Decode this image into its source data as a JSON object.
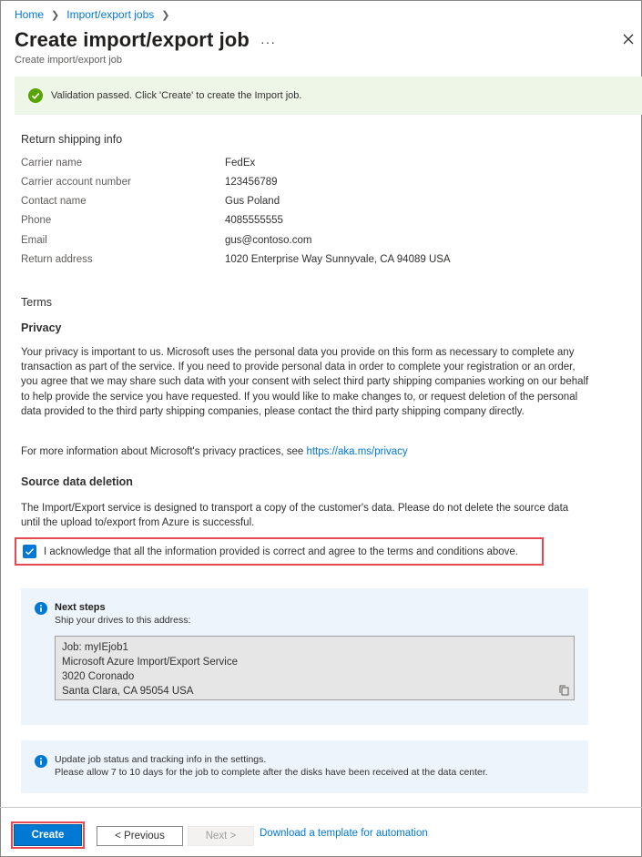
{
  "breadcrumb": [
    "Home",
    "Import/export jobs"
  ],
  "header": {
    "title": "Create import/export job",
    "subtitle": "Create import/export job",
    "more": "···"
  },
  "validation": {
    "message": "Validation passed. Click 'Create' to create the Import job."
  },
  "shipping": {
    "heading": "Return shipping info",
    "rows": [
      {
        "label": "Carrier name",
        "value": "FedEx"
      },
      {
        "label": "Carrier account number",
        "value": "123456789"
      },
      {
        "label": "Contact name",
        "value": "Gus Poland"
      },
      {
        "label": "Phone",
        "value": "4085555555"
      },
      {
        "label": "Email",
        "value": "gus@contoso.com"
      },
      {
        "label": "Return address",
        "value": "1020 Enterprise Way Sunnyvale, CA 94089 USA"
      }
    ]
  },
  "terms": {
    "heading": "Terms",
    "privacy_heading": "Privacy",
    "privacy_text": "Your privacy is important to us. Microsoft uses the personal data you provide on this form as necessary to complete any transaction as part of the service. If you need to provide personal data in order to complete your registration or an order, you agree that we may share such data with your consent with select third party shipping companies working on our behalf to help provide the service you have requested. If you would like to make changes to, or request deletion of the personal data provided to the third party shipping companies, please contact the third party shipping company directly.",
    "more_info_prefix": "For more information about Microsoft's privacy practices, see ",
    "more_info_link": "https://aka.ms/privacy",
    "deletion_heading": "Source data deletion",
    "deletion_text": "The Import/Export service is designed to transport a copy of the customer's data. Please do not delete the source data until the upload to/export from Azure is successful.",
    "acknowledge_label": "I acknowledge that all the information provided is correct and agree to the terms and conditions above.",
    "acknowledge_checked": true
  },
  "next_steps": {
    "title": "Next steps",
    "subtitle": "Ship your drives to this address:",
    "address_lines": [
      "Job: myIEjob1",
      "Microsoft Azure Import/Export Service",
      "3020 Coronado",
      "Santa Clara, CA 95054 USA"
    ]
  },
  "update_info": {
    "line1": "Update job status and tracking info in the settings.",
    "line2": "Please allow 7 to 10 days for the job to complete after the disks have been received at the data center."
  },
  "footer": {
    "create": "Create",
    "previous": "< Previous",
    "next": "Next >",
    "template_link": "Download a template for automation"
  },
  "colors": {
    "accent": "#0078d4",
    "success": "#57a300",
    "highlight": "#e74856"
  }
}
